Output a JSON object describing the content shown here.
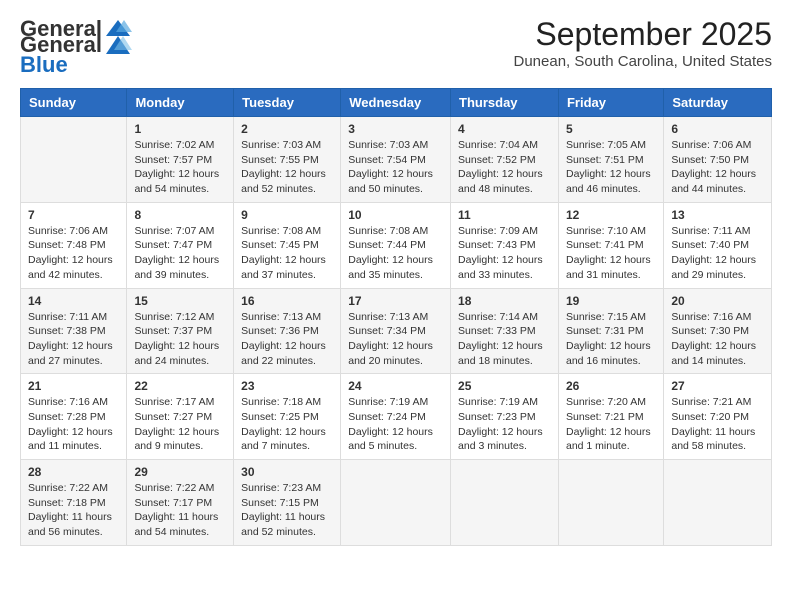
{
  "logo": {
    "general": "General",
    "blue": "Blue"
  },
  "header": {
    "month_year": "September 2025",
    "location": "Dunean, South Carolina, United States"
  },
  "days_of_week": [
    "Sunday",
    "Monday",
    "Tuesday",
    "Wednesday",
    "Thursday",
    "Friday",
    "Saturday"
  ],
  "weeks": [
    [
      {
        "day": "",
        "info": ""
      },
      {
        "day": "1",
        "info": "Sunrise: 7:02 AM\nSunset: 7:57 PM\nDaylight: 12 hours\nand 54 minutes."
      },
      {
        "day": "2",
        "info": "Sunrise: 7:03 AM\nSunset: 7:55 PM\nDaylight: 12 hours\nand 52 minutes."
      },
      {
        "day": "3",
        "info": "Sunrise: 7:03 AM\nSunset: 7:54 PM\nDaylight: 12 hours\nand 50 minutes."
      },
      {
        "day": "4",
        "info": "Sunrise: 7:04 AM\nSunset: 7:52 PM\nDaylight: 12 hours\nand 48 minutes."
      },
      {
        "day": "5",
        "info": "Sunrise: 7:05 AM\nSunset: 7:51 PM\nDaylight: 12 hours\nand 46 minutes."
      },
      {
        "day": "6",
        "info": "Sunrise: 7:06 AM\nSunset: 7:50 PM\nDaylight: 12 hours\nand 44 minutes."
      }
    ],
    [
      {
        "day": "7",
        "info": "Sunrise: 7:06 AM\nSunset: 7:48 PM\nDaylight: 12 hours\nand 42 minutes."
      },
      {
        "day": "8",
        "info": "Sunrise: 7:07 AM\nSunset: 7:47 PM\nDaylight: 12 hours\nand 39 minutes."
      },
      {
        "day": "9",
        "info": "Sunrise: 7:08 AM\nSunset: 7:45 PM\nDaylight: 12 hours\nand 37 minutes."
      },
      {
        "day": "10",
        "info": "Sunrise: 7:08 AM\nSunset: 7:44 PM\nDaylight: 12 hours\nand 35 minutes."
      },
      {
        "day": "11",
        "info": "Sunrise: 7:09 AM\nSunset: 7:43 PM\nDaylight: 12 hours\nand 33 minutes."
      },
      {
        "day": "12",
        "info": "Sunrise: 7:10 AM\nSunset: 7:41 PM\nDaylight: 12 hours\nand 31 minutes."
      },
      {
        "day": "13",
        "info": "Sunrise: 7:11 AM\nSunset: 7:40 PM\nDaylight: 12 hours\nand 29 minutes."
      }
    ],
    [
      {
        "day": "14",
        "info": "Sunrise: 7:11 AM\nSunset: 7:38 PM\nDaylight: 12 hours\nand 27 minutes."
      },
      {
        "day": "15",
        "info": "Sunrise: 7:12 AM\nSunset: 7:37 PM\nDaylight: 12 hours\nand 24 minutes."
      },
      {
        "day": "16",
        "info": "Sunrise: 7:13 AM\nSunset: 7:36 PM\nDaylight: 12 hours\nand 22 minutes."
      },
      {
        "day": "17",
        "info": "Sunrise: 7:13 AM\nSunset: 7:34 PM\nDaylight: 12 hours\nand 20 minutes."
      },
      {
        "day": "18",
        "info": "Sunrise: 7:14 AM\nSunset: 7:33 PM\nDaylight: 12 hours\nand 18 minutes."
      },
      {
        "day": "19",
        "info": "Sunrise: 7:15 AM\nSunset: 7:31 PM\nDaylight: 12 hours\nand 16 minutes."
      },
      {
        "day": "20",
        "info": "Sunrise: 7:16 AM\nSunset: 7:30 PM\nDaylight: 12 hours\nand 14 minutes."
      }
    ],
    [
      {
        "day": "21",
        "info": "Sunrise: 7:16 AM\nSunset: 7:28 PM\nDaylight: 12 hours\nand 11 minutes."
      },
      {
        "day": "22",
        "info": "Sunrise: 7:17 AM\nSunset: 7:27 PM\nDaylight: 12 hours\nand 9 minutes."
      },
      {
        "day": "23",
        "info": "Sunrise: 7:18 AM\nSunset: 7:25 PM\nDaylight: 12 hours\nand 7 minutes."
      },
      {
        "day": "24",
        "info": "Sunrise: 7:19 AM\nSunset: 7:24 PM\nDaylight: 12 hours\nand 5 minutes."
      },
      {
        "day": "25",
        "info": "Sunrise: 7:19 AM\nSunset: 7:23 PM\nDaylight: 12 hours\nand 3 minutes."
      },
      {
        "day": "26",
        "info": "Sunrise: 7:20 AM\nSunset: 7:21 PM\nDaylight: 12 hours\nand 1 minute."
      },
      {
        "day": "27",
        "info": "Sunrise: 7:21 AM\nSunset: 7:20 PM\nDaylight: 11 hours\nand 58 minutes."
      }
    ],
    [
      {
        "day": "28",
        "info": "Sunrise: 7:22 AM\nSunset: 7:18 PM\nDaylight: 11 hours\nand 56 minutes."
      },
      {
        "day": "29",
        "info": "Sunrise: 7:22 AM\nSunset: 7:17 PM\nDaylight: 11 hours\nand 54 minutes."
      },
      {
        "day": "30",
        "info": "Sunrise: 7:23 AM\nSunset: 7:15 PM\nDaylight: 11 hours\nand 52 minutes."
      },
      {
        "day": "",
        "info": ""
      },
      {
        "day": "",
        "info": ""
      },
      {
        "day": "",
        "info": ""
      },
      {
        "day": "",
        "info": ""
      }
    ]
  ]
}
